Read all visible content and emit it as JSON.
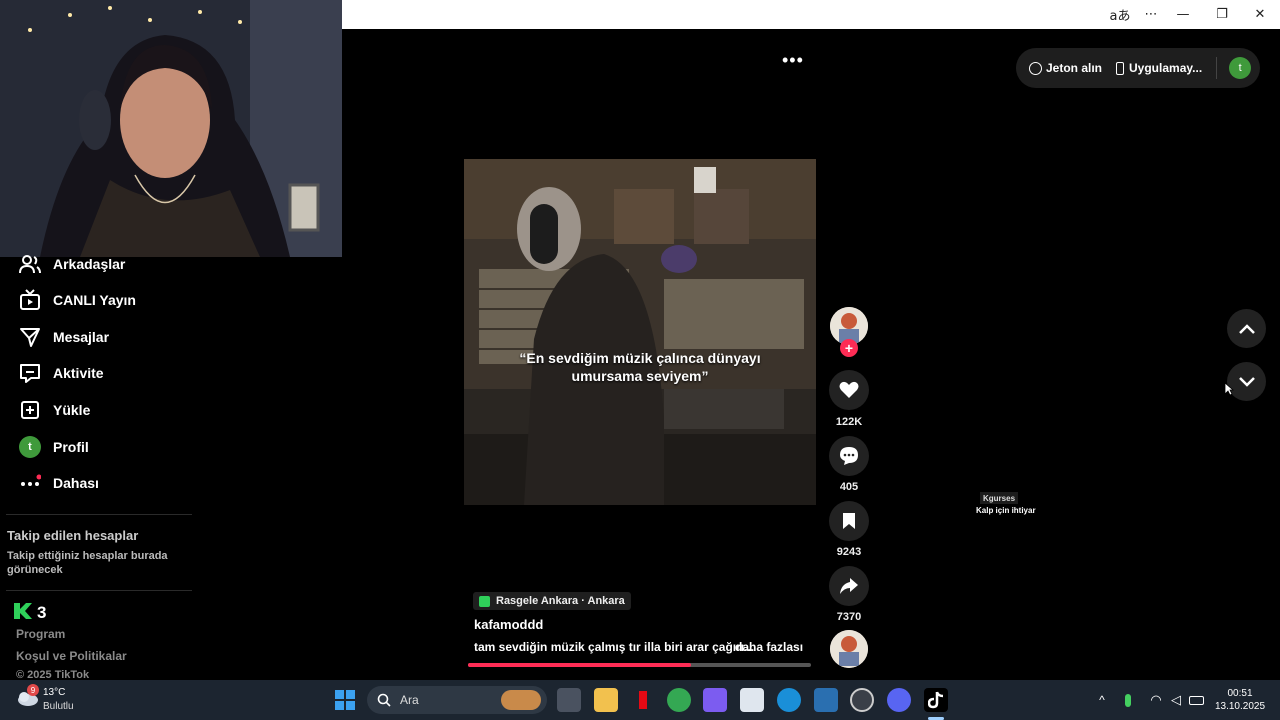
{
  "window": {
    "controls": [
      "aあ",
      "⋯",
      "—",
      "❐",
      "✕"
    ]
  },
  "sidebar": {
    "items": [
      {
        "label": "Arkadaşlar",
        "icon": "friends-icon"
      },
      {
        "label": "CANLI Yayın",
        "icon": "live-icon"
      },
      {
        "label": "Mesajlar",
        "icon": "messages-icon"
      },
      {
        "label": "Aktivite",
        "icon": "activity-icon"
      },
      {
        "label": "Yükle",
        "icon": "upload-icon"
      },
      {
        "label": "Profil",
        "icon": "profile-avatar",
        "avatar_letter": "t"
      },
      {
        "label": "Dahası",
        "icon": "more-icon"
      }
    ],
    "following_title": "Takip edilen hesaplar",
    "following_subtitle": "Takip ettiğiniz hesaplar burada görünecek",
    "footer": {
      "links": [
        "Program",
        "Koşul ve Politikalar"
      ],
      "copyright": "© 2025 TikTok"
    }
  },
  "topbar": {
    "coins_label": "Jeton alın",
    "app_label": "Uygulamay...",
    "avatar_letter": "t"
  },
  "video": {
    "caption_line1": "“En sevdiğim müzik çalınca dünyayı",
    "caption_line2": "umursama seviyem”",
    "location": "Rasgele Ankara · Ankara",
    "username": "kafamoddd",
    "description": "tam sevdiğin müzik çalmış tır illa biri arar çağırı...",
    "more_label": "daha fazlası",
    "progress_fraction": 0.65
  },
  "actions": {
    "likes": "122K",
    "comments": "405",
    "saves": "9243",
    "shares": "7370"
  },
  "music_tooltip": {
    "user": "Kgurses",
    "song": "Kalp için ihtiyar"
  },
  "taskbar": {
    "weather_temp": "13°C",
    "weather_desc": "Bulutlu",
    "weather_badge": "9",
    "search_placeholder": "Ara",
    "time": "00:51",
    "date": "13.10.2025"
  },
  "colors": {
    "accent": "#fe2c55",
    "avatar": "#3f9a3b",
    "taskbar": "#1c2530"
  }
}
